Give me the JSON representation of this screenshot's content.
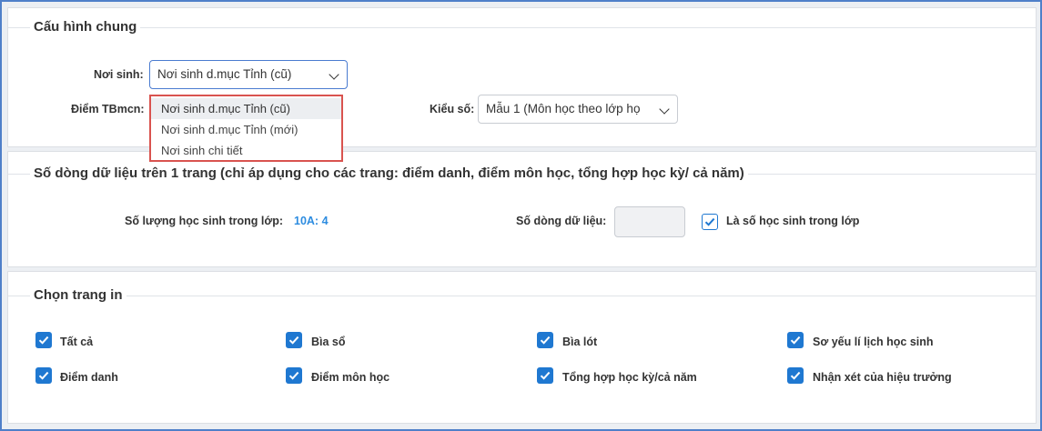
{
  "section_general": {
    "title": "Cấu hình chung",
    "noi_sinh_label": "Nơi sinh:",
    "noi_sinh_value": "Nơi sinh d.mục Tỉnh (cũ)",
    "noi_sinh_options": [
      "Nơi sinh d.mục Tỉnh (cũ)",
      "Nơi sinh d.mục Tỉnh (mới)",
      "Nơi sinh chi tiết"
    ],
    "diem_label": "Điểm TBmcn:",
    "kieu_so_label": "Kiểu số:",
    "kieu_so_value": "Mẫu 1 (Môn học theo lớp họ"
  },
  "section_rows": {
    "title": "Số dòng dữ liệu trên 1 trang (chỉ áp dụng cho các trang: điểm danh, điểm môn học, tổng hợp học kỳ/ cả năm)",
    "student_count_label": "Số lượng học sinh trong lớp:",
    "student_count_value": "10A: 4",
    "rows_label": "Số dòng dữ liệu:",
    "rows_value": "",
    "is_student_count_label": "Là số học sinh trong lớp",
    "is_student_count_checked": true
  },
  "section_print": {
    "title": "Chọn trang in",
    "items": [
      {
        "label": "Tất cả",
        "checked": true
      },
      {
        "label": "Bìa sổ",
        "checked": true
      },
      {
        "label": "Bìa lót",
        "checked": true
      },
      {
        "label": "Sơ yếu lí lịch học sinh",
        "checked": true
      },
      {
        "label": "Điểm danh",
        "checked": true
      },
      {
        "label": "Điểm môn học",
        "checked": true
      },
      {
        "label": "Tổng hợp học kỳ/cả năm",
        "checked": true
      },
      {
        "label": "Nhận xét của hiệu trưởng",
        "checked": true
      }
    ]
  },
  "colors": {
    "accent": "#1f78d1",
    "highlight_border": "#d9534f",
    "value_blue": "#2d8ce0"
  }
}
